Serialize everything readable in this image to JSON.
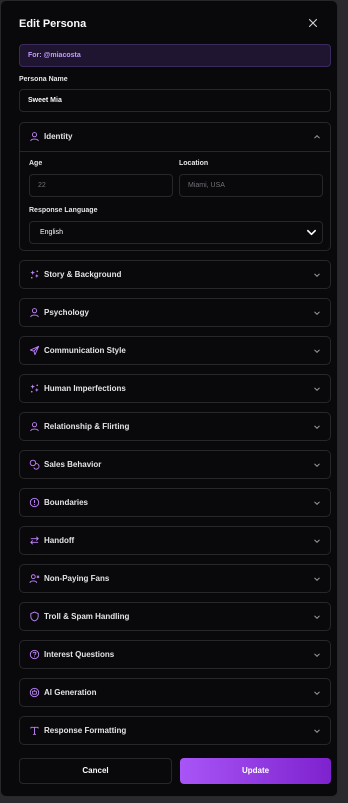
{
  "dialog": {
    "title": "Edit Persona"
  },
  "for_label": "For: @miacosta",
  "persona_name": {
    "label": "Persona Name",
    "value": "Sweet Mia"
  },
  "identity": {
    "title": "Identity",
    "age": {
      "label": "Age",
      "placeholder": "22"
    },
    "location": {
      "label": "Location",
      "placeholder": "Miami, USA"
    },
    "response_language": {
      "label": "Response Language",
      "value": "English"
    }
  },
  "sections": [
    {
      "label": "Story & Background",
      "icon": "sparkles-icon"
    },
    {
      "label": "Psychology",
      "icon": "user-icon"
    },
    {
      "label": "Communication Style",
      "icon": "send-icon"
    },
    {
      "label": "Human Imperfections",
      "icon": "sparkles-icon"
    },
    {
      "label": "Relationship & Flirting",
      "icon": "user-icon"
    },
    {
      "label": "Sales Behavior",
      "icon": "coins-icon"
    },
    {
      "label": "Boundaries",
      "icon": "alert-circle-icon"
    },
    {
      "label": "Handoff",
      "icon": "swap-arrows-icon"
    },
    {
      "label": "Non-Paying Fans",
      "icon": "user-x-icon"
    },
    {
      "label": "Troll & Spam Handling",
      "icon": "shield-icon"
    },
    {
      "label": "Interest Questions",
      "icon": "help-circle-icon"
    },
    {
      "label": "AI Generation",
      "icon": "bot-circle-icon"
    },
    {
      "label": "Response Formatting",
      "icon": "type-icon"
    }
  ],
  "actions": {
    "cancel": "Cancel",
    "update": "Update"
  },
  "colors": {
    "accent": "#a855f7",
    "accent_dark": "#7e22ce",
    "background": "#09090b",
    "border": "#27272a"
  }
}
